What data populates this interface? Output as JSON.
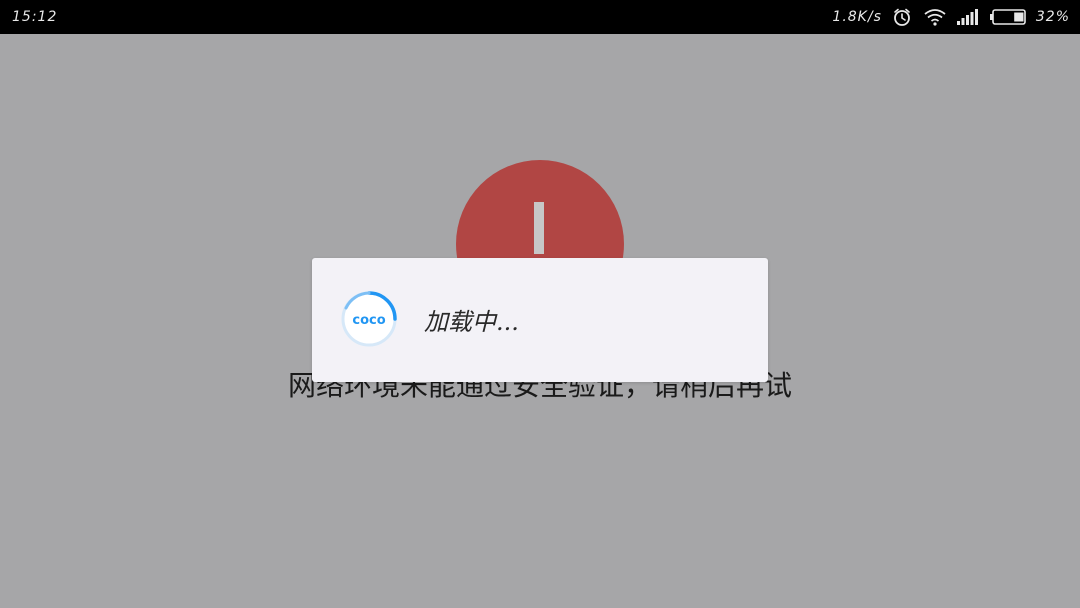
{
  "status_bar": {
    "time": "15:12",
    "net_speed": "1.8K/s",
    "battery_percent": "32%",
    "battery_level": 0.32,
    "icons": [
      "alarm-icon",
      "wifi-icon",
      "signal-icon",
      "battery-icon"
    ]
  },
  "error_page": {
    "message": "网络环境未能通过安全验证，请稍后再试",
    "icon": "error-exclamation-icon",
    "icon_color": "#b14644"
  },
  "loading_dialog": {
    "logo_text": "coco",
    "logo_icon": "coco-spinner-icon",
    "text": "加载中..."
  },
  "colors": {
    "background": "#a6a6a8",
    "dialog_background": "#f3f2f7",
    "accent": "#2196f3"
  }
}
